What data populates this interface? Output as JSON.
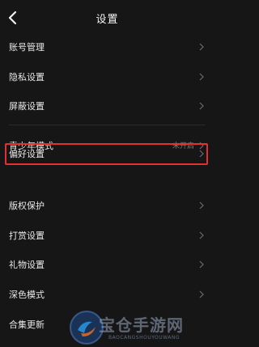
{
  "header": {
    "title": "设置",
    "back_icon": "chevron-left-icon"
  },
  "menu": {
    "items": [
      {
        "label": "账号管理"
      },
      {
        "label": "隐私设置"
      },
      {
        "label": "屏蔽设置"
      },
      {
        "label": "青少年模式",
        "status": "未开启"
      },
      {
        "label": "偏好设置",
        "highlighted": true
      },
      {
        "label": "版权保护"
      },
      {
        "label": "打赏设置"
      },
      {
        "label": "礼物设置"
      },
      {
        "label": "深色模式"
      },
      {
        "label": "合集更新"
      }
    ]
  },
  "watermark": {
    "title": "宝仓手游网",
    "subtitle": "BAOCANGSHOUYOUWANG"
  },
  "colors": {
    "background": "#161616",
    "highlight": "#e53030"
  }
}
